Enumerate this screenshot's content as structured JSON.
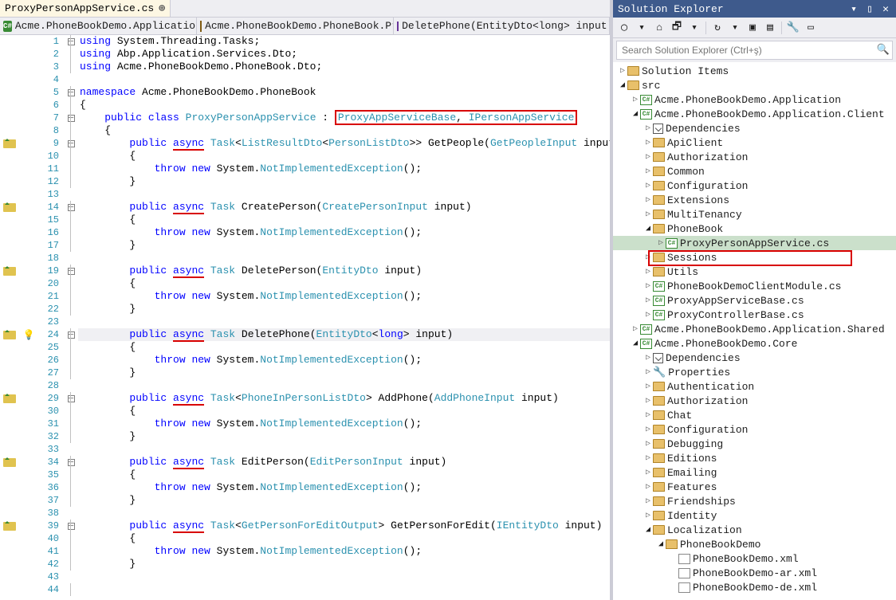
{
  "tab": {
    "name": "ProxyPersonAppService.cs"
  },
  "nav": {
    "scope1": "Acme.PhoneBookDemo.Application.Clien",
    "scope2": "Acme.PhoneBookDemo.PhoneBook.Prox",
    "scope3": "DeletePhone(EntityDto<long> input)"
  },
  "code": {
    "kw_using": "using",
    "kw_namespace": "namespace",
    "kw_public": "public",
    "kw_class": "class",
    "kw_async": "async",
    "kw_throw": "throw",
    "kw_new": "new",
    "kw_long": "long",
    "ns1": " System.Threading.Tasks;",
    "ns2": " Abp.Application.Services.Dto;",
    "ns3": " Acme.PhoneBookDemo.PhoneBook.Dto;",
    "ns_decl": " Acme.PhoneBookDemo.PhoneBook",
    "class_name": "ProxyPersonAppService",
    "colon": " : ",
    "base1": "ProxyAppServiceBase",
    "comma": ", ",
    "iface": "IPersonAppService",
    "task": "Task",
    "lt": "<",
    "gt": ">",
    "gt2": ">>",
    "listresult": "ListResultDto",
    "personlist": "PersonListDto",
    "getpeople": " GetPeople(",
    "getpeopleinput": "GetPeopleInput",
    "pinput": " input)",
    "throw_pre": "                    ",
    "throw_mid": " System.",
    "nie": "NotImplementedException",
    "paren": "();",
    "createperson": " CreatePerson(",
    "createinput": "CreatePersonInput",
    "deleteperson": " DeletePerson(",
    "entitydto": "EntityDto",
    "deletephone": " DeletePhone(",
    "entlong_input": "> input)",
    "phoneinperson": "PhoneInPersonListDto",
    "addphone": "> AddPhone(",
    "addphoneinput": "AddPhoneInput",
    "editperson": " EditPerson(",
    "editinput": "EditPersonInput",
    "getpersonedit": "GetPersonForEditOutput",
    "getpersoneditm": "> GetPersonForEdit(",
    "ientitydto": "IEntityDto",
    "ob": "{",
    "cb": "}"
  },
  "solutionExplorer": {
    "title": "Solution Explorer",
    "searchPlaceholder": "Search Solution Explorer (Ctrl+ş)",
    "items": {
      "solutionItems": "Solution Items",
      "src": "src",
      "app": "Acme.PhoneBookDemo.Application",
      "client": "Acme.PhoneBookDemo.Application.Client",
      "deps": "Dependencies",
      "apiclient": "ApiClient",
      "auth": "Authorization",
      "common": "Common",
      "config": "Configuration",
      "ext": "Extensions",
      "multi": "MultiTenancy",
      "phonebook": "PhoneBook",
      "proxyfile": "ProxyPersonAppService.cs",
      "sessions": "Sessions",
      "utils": "Utils",
      "clientmod": "PhoneBookDemoClientModule.cs",
      "proxybase": "ProxyAppServiceBase.cs",
      "proxyctrl": "ProxyControllerBase.cs",
      "shared": "Acme.PhoneBookDemo.Application.Shared",
      "core": "Acme.PhoneBookDemo.Core",
      "props": "Properties",
      "authn": "Authentication",
      "chat": "Chat",
      "debug": "Debugging",
      "editions": "Editions",
      "email": "Emailing",
      "features": "Features",
      "friends": "Friendships",
      "identity": "Identity",
      "local": "Localization",
      "pbdemo": "PhoneBookDemo",
      "xml1": "PhoneBookDemo.xml",
      "xml2": "PhoneBookDemo-ar.xml",
      "xml3": "PhoneBookDemo-de.xml"
    }
  }
}
